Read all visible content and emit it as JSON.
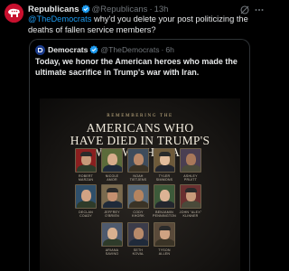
{
  "post": {
    "author_name": "Republicans",
    "author_handle": "@Republicans",
    "time": "13h",
    "mention": "@TheDemocrats",
    "text": " why'd you delete your post politicizing the deaths of fallen service members?"
  },
  "quote": {
    "author_name": "Democrats",
    "author_handle": "@TheDemocrats",
    "time": "6h",
    "text": "Today, we honor the American heroes who made the ultimate sacrifice in Trump's war with Iran."
  },
  "poster": {
    "remembering": "REMEMBERING THE",
    "title_line1": "AMERICANS WHO",
    "title_line2": "HAVE DIED IN TRUMP'S",
    "title_line3": "WAR WITH IRAN",
    "people": [
      {
        "name": "ROBERT\nMARZAN"
      },
      {
        "name": "NICOLE\nAMOR"
      },
      {
        "name": "NOAH\nTIETJENS"
      },
      {
        "name": "TYLER\nSIMMONS"
      },
      {
        "name": "ASHLEY\nPRUITT"
      },
      {
        "name": "DECLAN\nCOADY"
      },
      {
        "name": "JEFFREY\nO'BRIEN"
      },
      {
        "name": "CODY\nKHORK"
      },
      {
        "name": "BENJAMIN\nPENNINGTON"
      },
      {
        "name": "JOHN \"ALEX\"\nKLINNER"
      },
      {
        "name": "ARIANA\nSAVINO"
      },
      {
        "name": "SETH\nKOVAL"
      },
      {
        "name": "TYSON\nALLEN"
      }
    ]
  },
  "colors": {
    "link": "#1d9bf0",
    "verified": "#1d9bf0",
    "republican_red": "#c8102e",
    "democrat_blue": "#1a3a8a"
  }
}
